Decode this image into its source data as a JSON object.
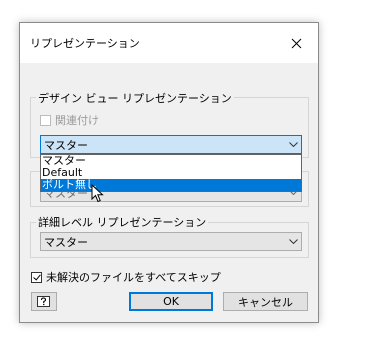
{
  "dialog": {
    "title": "リプレゼンテーション"
  },
  "design_view_group": {
    "label": "デザイン ビュー リプレゼンテーション",
    "associative_checkbox": {
      "label": "関連付け",
      "checked": false,
      "enabled": false
    },
    "combo_value": "マスター"
  },
  "dropdown": {
    "options": [
      "マスター",
      "Default",
      "ボルト無し"
    ],
    "highlighted_index": 2
  },
  "positional_combo_value": "マスター",
  "lod_group": {
    "label": "詳細レベル リプレゼンテーション",
    "combo_value": "マスター"
  },
  "skip_checkbox": {
    "label": "未解決のファイルをすべてスキップ",
    "checked": true
  },
  "buttons": {
    "help_icon": "help-icon",
    "ok_label": "OK",
    "cancel_label": "キャンセル"
  },
  "colors": {
    "accent": "#0078d7",
    "combo_active_bg": "#cce4f7",
    "dialog_bg": "#f0f0f0"
  }
}
